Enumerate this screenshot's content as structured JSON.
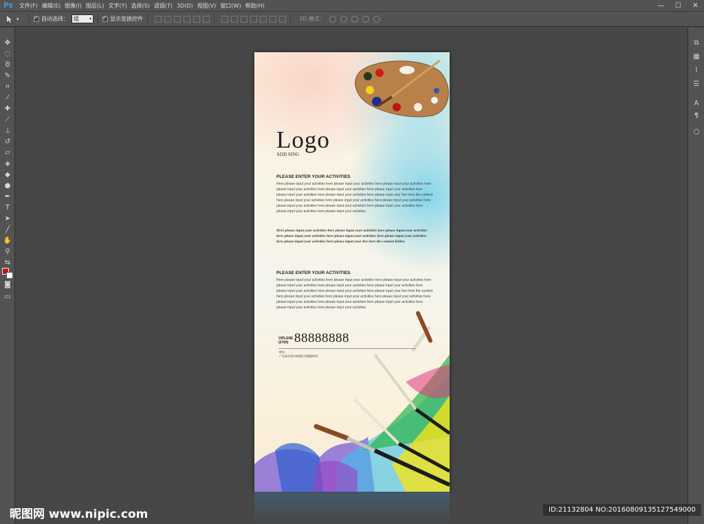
{
  "app": {
    "logo": "Ps"
  },
  "menu": [
    "文件(F)",
    "编辑(E)",
    "图像(I)",
    "图层(L)",
    "文字(Y)",
    "选择(S)",
    "滤镜(T)",
    "3D(D)",
    "视图(V)",
    "窗口(W)",
    "帮助(H)"
  ],
  "window_controls": {
    "minimize": "—",
    "maximize": "☐",
    "close": "✕"
  },
  "options": {
    "auto_select_label": "自动选择：",
    "auto_select_value": "组",
    "show_transform_label": "显示变换控件",
    "mode3d_label": "3D 模式："
  },
  "poster": {
    "logo": "Logo",
    "addsing": "ADD SING",
    "heading1": "PLEASE ENTER YOUR ACTIVITIES",
    "para1": "Here please input your activities here please input your activities here please input your activities here please input your activities here please input your activities here please input your activities here please input your activities here please input your activities here please input your live here the content here please input your activities here please input your activities here please input your activities here please input your activities here please input your activities here please input your activities here please input your activities here please input your activities",
    "script": "Here please input your activities here please input your activities here please input your activities here please input your activities here please input your activities here please input your activities here please input your activities here please input your live here the content lirilies",
    "heading2": "PLEASE ENTER YOUR ACTIVITIES",
    "para2": "Here please input your activities here please input your activities here please input your activities here please input your activities here please input your activities here please input your activities here please input your activities here please input your activities here please input your live here the content here please input your activities here please input your activities here please input your activities here please input your activities here please input your activities here please input your activities here please input your activities here please input your activities",
    "vip_label": "VIPLENE",
    "vip_code": "(0769)",
    "phone": "88888888",
    "addr_label": "地址：",
    "addr": "广东省东莞市南城区鸿福路88号"
  },
  "watermark": {
    "site": "昵图网 www.nipic.com",
    "id": "ID:21132804 NO:20160809135127549000"
  }
}
